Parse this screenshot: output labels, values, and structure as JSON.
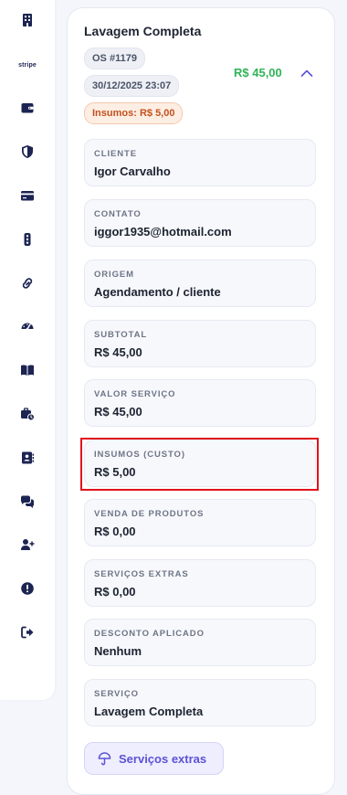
{
  "colors": {
    "accent": "#5b52d6",
    "price_green": "#2fb457",
    "warning_orange": "#c2521f",
    "highlight_red": "#e0121b",
    "nav_icon": "#1c2452"
  },
  "sidebar": {
    "items": [
      {
        "icon": "building-icon"
      },
      {
        "icon": "stripe-logo",
        "text": "stripe"
      },
      {
        "icon": "wallet-icon"
      },
      {
        "icon": "shield-icon"
      },
      {
        "icon": "credit-card-icon"
      },
      {
        "icon": "traffic-light-icon"
      },
      {
        "icon": "link-icon"
      },
      {
        "icon": "gauge-icon"
      },
      {
        "icon": "book-icon"
      },
      {
        "icon": "briefcase-clock-icon"
      },
      {
        "icon": "contact-card-icon"
      },
      {
        "icon": "chat-bubbles-icon"
      },
      {
        "icon": "user-plus-icon"
      },
      {
        "icon": "alert-circle-icon"
      },
      {
        "icon": "sign-out-icon"
      }
    ]
  },
  "order": {
    "title": "Lavagem Completa",
    "os_number": "OS #1179",
    "datetime": "30/12/2025 23:07",
    "supplies_badge": "Insumos: R$ 5,00",
    "price": "R$ 45,00",
    "expanded": true
  },
  "fields": [
    {
      "label": "CLIENTE",
      "value": "Igor Carvalho"
    },
    {
      "label": "CONTATO",
      "value": "iggor1935@hotmail.com"
    },
    {
      "label": "ORIGEM",
      "value": "Agendamento / cliente"
    },
    {
      "label": "SUBTOTAL",
      "value": "R$ 45,00"
    },
    {
      "label": "VALOR SERVIÇO",
      "value": "R$ 45,00"
    },
    {
      "label": "INSUMOS (CUSTO)",
      "value": "R$ 5,00",
      "highlighted": true
    },
    {
      "label": "VENDA DE PRODUTOS",
      "value": "R$ 0,00"
    },
    {
      "label": "SERVIÇOS EXTRAS",
      "value": "R$ 0,00"
    },
    {
      "label": "DESCONTO APLICADO",
      "value": "Nenhum"
    },
    {
      "label": "SERVIÇO",
      "value": "Lavagem Completa"
    }
  ],
  "actions": {
    "extras_button_label": "Serviços extras",
    "extras_button_icon": "umbrella-icon"
  }
}
